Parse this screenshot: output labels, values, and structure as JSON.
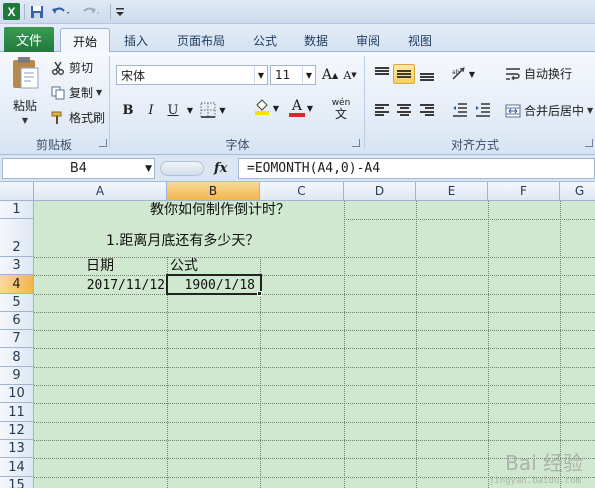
{
  "quick_access": {
    "logo": "X",
    "save_icon": "save-icon",
    "undo_icon": "undo-icon",
    "redo_icon": "redo-icon"
  },
  "tabs": [
    "文件",
    "开始",
    "插入",
    "页面布局",
    "公式",
    "数据",
    "审阅",
    "视图"
  ],
  "active_tab": "开始",
  "ribbon": {
    "clipboard": {
      "paste": "粘贴",
      "cut": "剪切",
      "copy": "复制",
      "format_painter": "格式刷",
      "label": "剪贴板"
    },
    "font": {
      "name": "宋体",
      "size": "11",
      "bold": "B",
      "italic": "I",
      "underline": "U",
      "grow": "A",
      "shrink": "A",
      "wen": "wén",
      "font_color": "A",
      "label": "字体"
    },
    "alignment": {
      "wrap_text": "自动换行",
      "merge_center": "合并后居中",
      "label": "对齐方式"
    }
  },
  "formula_bar": {
    "name_box": "B4",
    "fx": "fx",
    "formula": "=EOMONTH(A4,0)-A4"
  },
  "columns": [
    "A",
    "B",
    "C",
    "D",
    "E",
    "F",
    "G"
  ],
  "selected_column": "B",
  "rows": [
    "1",
    "2",
    "3",
    "4",
    "5",
    "6",
    "7",
    "8",
    "9",
    "10",
    "11",
    "12",
    "13",
    "14",
    "15"
  ],
  "selected_row": "4",
  "cells": {
    "r1": "教你如何制作倒计时？",
    "r2": "1.距离月底还有多少天？",
    "a3": "日期",
    "b3": "公式",
    "a4": "2017/11/12",
    "b4": "1900/1/18"
  },
  "watermark": {
    "text": "Bai 经验",
    "sub": "jingyan.baidu.com"
  }
}
